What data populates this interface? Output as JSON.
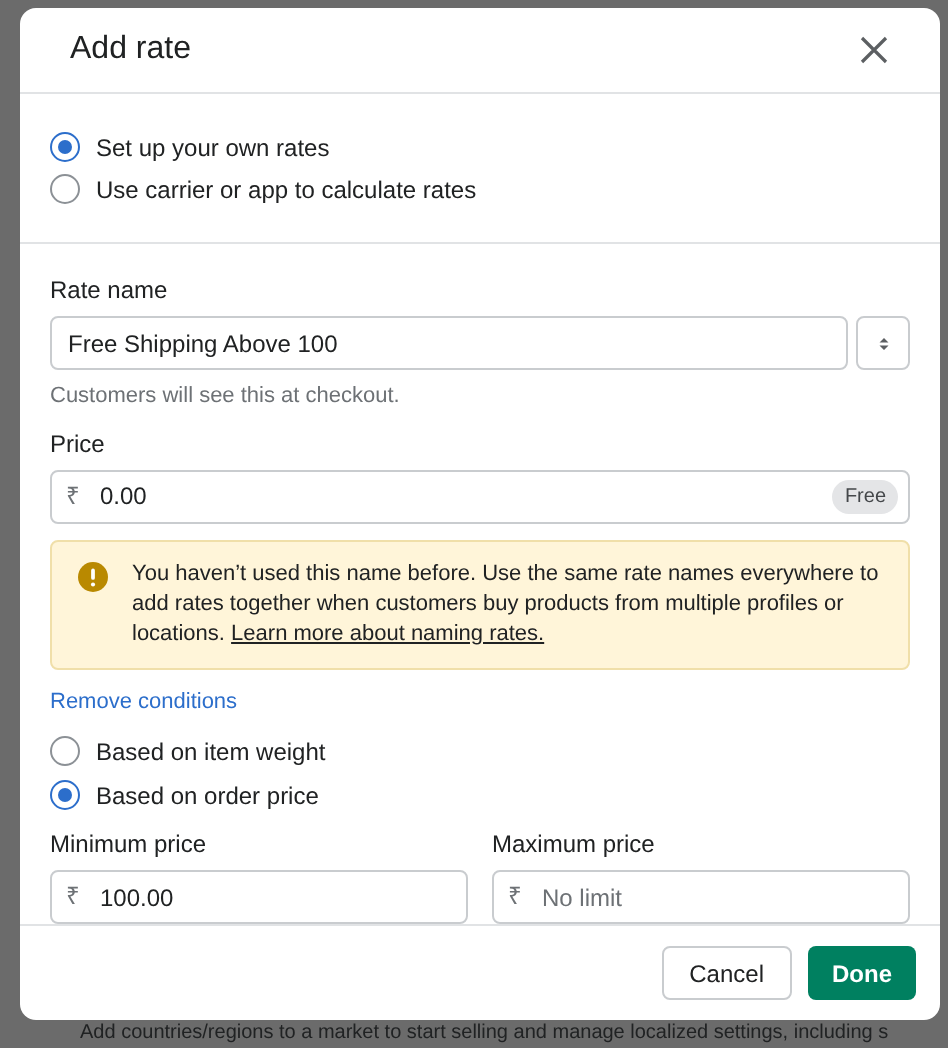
{
  "background_text": "Add countries/regions to a market to start selling and manage localized settings, including s",
  "dialog": {
    "title": "Add rate"
  },
  "rate_source": [
    {
      "label": "Set up your own rates",
      "selected": true
    },
    {
      "label": "Use carrier or app to calculate rates",
      "selected": false
    }
  ],
  "rate_name": {
    "label": "Rate name",
    "value": "Free Shipping Above 100",
    "help": "Customers will see this at checkout."
  },
  "price": {
    "label": "Price",
    "currency": "₹",
    "value": "0.00",
    "badge": "Free"
  },
  "banner": {
    "text": "You haven’t used this name before. Use the same rate names everywhere to add rates together when customers buy products from multiple profiles or locations.",
    "link": "Learn more about naming rates."
  },
  "remove_conditions": "Remove conditions",
  "conditions": [
    {
      "label": "Based on item weight",
      "selected": false
    },
    {
      "label": "Based on order price",
      "selected": true
    }
  ],
  "min_price": {
    "label": "Minimum price",
    "currency": "₹",
    "value": "100.00"
  },
  "max_price": {
    "label": "Maximum price",
    "currency": "₹",
    "placeholder": "No limit"
  },
  "buttons": {
    "cancel": "Cancel",
    "done": "Done"
  }
}
